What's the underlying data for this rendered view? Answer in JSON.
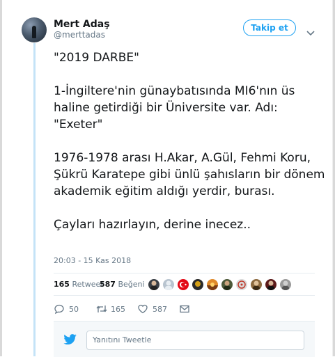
{
  "author": {
    "name": "Mert Adaş",
    "handle": "@merttadas"
  },
  "follow_button": {
    "label": "Takip et"
  },
  "tweet": {
    "text": "\"2019 DARBE\"\n\n1-İngiltere'nin günaybatısında MI6'nın üs haline getirdiği bir Üniversite var. Adı: \"Exeter\"\n\n1976-1978 arası H.Akar, A.Gül, Fehmi Koru, Şükrü Karatepe gibi ünlü şahısların bir dönem akademik eğitim aldığı yerdir, burası.\n\nÇayları hazırlayın, derine inecez..",
    "timestamp": "20:03 - 15 Kas 2018"
  },
  "stats": {
    "retweets": {
      "count": "165",
      "label": "Retweet"
    },
    "likes": {
      "count": "587",
      "label": "Beğeni"
    }
  },
  "liker_avatars": [
    {
      "icon": "portrait-avatar",
      "color": "#3a3f45"
    },
    {
      "icon": "default-avatar",
      "color": "#b8c4cf"
    },
    {
      "icon": "turkish-flag-avatar",
      "color": "#e30a17"
    },
    {
      "icon": "dark-avatar",
      "color": "#2b2b2b"
    },
    {
      "icon": "sunset-avatar",
      "color": "#e08a2a"
    },
    {
      "icon": "portrait-avatar",
      "color": "#4d5a3a"
    },
    {
      "icon": "emblem-avatar",
      "color": "#d9d9d9"
    },
    {
      "icon": "portrait-avatar",
      "color": "#8c6a3f"
    },
    {
      "icon": "portrait-avatar",
      "color": "#5c1a1a"
    },
    {
      "icon": "portrait-avatar",
      "color": "#9a9a9a"
    }
  ],
  "actions": {
    "reply": {
      "icon": "reply-icon",
      "count": "50"
    },
    "retweet": {
      "icon": "retweet-icon",
      "count": "165"
    },
    "like": {
      "icon": "heart-icon",
      "count": "587"
    },
    "message": {
      "icon": "envelope-icon"
    }
  },
  "reply_box": {
    "placeholder": "Yanıtını Tweetle"
  },
  "colors": {
    "accent": "#1da1f2",
    "thread_line": "#c4e3f7",
    "secondary_text": "#657786"
  }
}
